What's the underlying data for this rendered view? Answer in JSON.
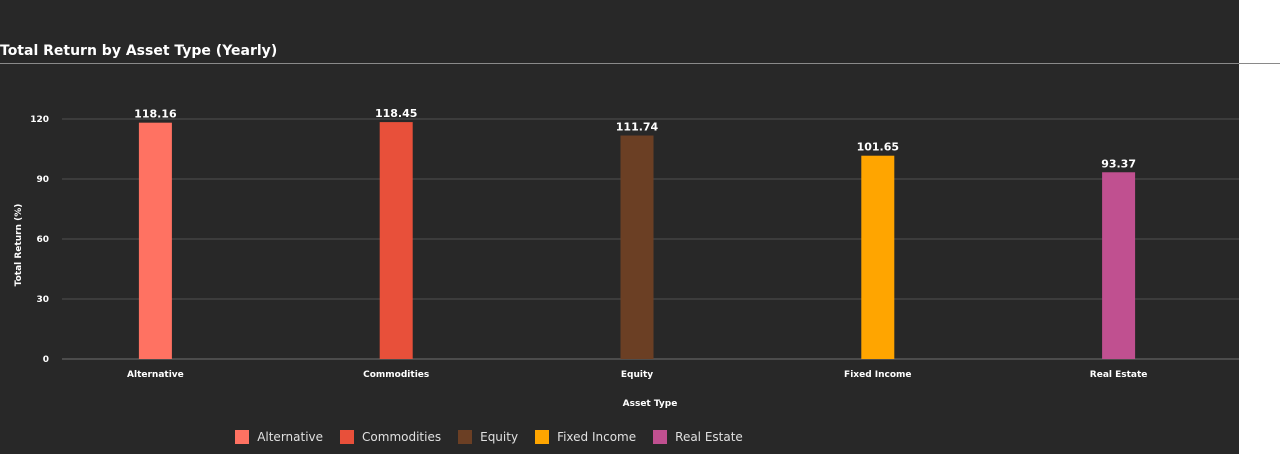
{
  "chart_data": {
    "type": "bar",
    "title": "Total Return by Asset Type (Yearly)",
    "xlabel": "Asset Type",
    "ylabel": "Total Return (%)",
    "categories": [
      "Alternative",
      "Commodities",
      "Equity",
      "Fixed Income",
      "Real Estate"
    ],
    "values": [
      118.16,
      118.45,
      111.74,
      101.65,
      93.37
    ],
    "value_labels": [
      "118.16",
      "118.45",
      "111.74",
      "101.65",
      "93.37"
    ],
    "colors": [
      "#ff7262",
      "#e8503a",
      "#6b3f24",
      "#ffa500",
      "#c05090"
    ],
    "ylim": [
      0,
      120
    ],
    "yticks": [
      0,
      30,
      60,
      90,
      120
    ],
    "grid": true,
    "legend": "bottom"
  }
}
